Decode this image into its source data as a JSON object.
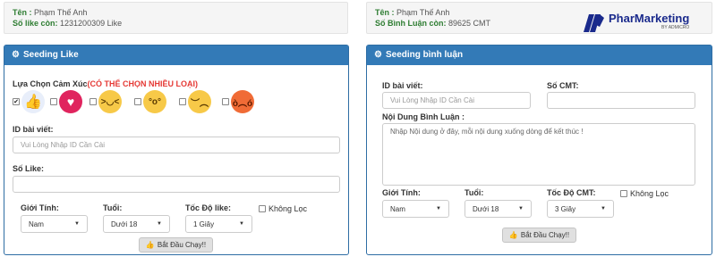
{
  "left_info": {
    "name_label": "Tên :",
    "name_value": "Phạm Thế Anh",
    "count_label": "Số like còn:",
    "count_value": "1231200309 Like"
  },
  "right_info": {
    "name_label": "Tên :",
    "name_value": "Phạm Thế Anh",
    "count_label": "Số Bình Luận còn:",
    "count_value": "89625 CMT"
  },
  "logo": {
    "brand": "PharMarketing",
    "by": "BY ADMICRO"
  },
  "like_panel": {
    "title": "Seeding Like",
    "emotion_label": "Lựa Chọn Cảm Xúc",
    "emotion_note": "(CÓ THỂ CHỌN NHIỀU LOẠI)",
    "emotions": [
      {
        "name": "like",
        "checked": true
      },
      {
        "name": "love",
        "checked": false
      },
      {
        "name": "haha",
        "checked": false
      },
      {
        "name": "wow",
        "checked": false
      },
      {
        "name": "sad",
        "checked": false
      },
      {
        "name": "angry",
        "checked": false
      }
    ],
    "post_id_label": "ID bài viết:",
    "post_id_placeholder": "Vui Lòng Nhập ID Cần Cài",
    "like_count_label": "Số Like:",
    "like_count_value": "",
    "gender_label": "Giới Tính:",
    "gender_value": "Nam",
    "age_label": "Tuổi:",
    "age_value": "Dưới 18",
    "speed_label": "Tốc Độ like:",
    "speed_value": "1 Giây",
    "nofilter_label": "Không Lọc",
    "start_label": "Bắt Đầu Chạy!!"
  },
  "comment_panel": {
    "title": "Seeding bình luận",
    "post_id_label": "ID bài viết:",
    "post_id_placeholder": "Vui Lòng Nhập ID Cần Cài",
    "cmt_count_label": "Số CMT:",
    "cmt_count_value": "",
    "content_label": "Nội Dung Bình Luận :",
    "content_placeholder": "Nhập Nội dung ở đây, mỗi nội dung xuống dòng để kết thúc !",
    "gender_label": "Giới Tính:",
    "gender_value": "Nam",
    "age_label": "Tuổi:",
    "age_value": "Dưới 18",
    "speed_label": "Tốc Độ CMT:",
    "speed_value": "3 Giây",
    "nofilter_label": "Không Lọc",
    "start_label": "Bắt Đầu Chạy!!"
  },
  "colors": {
    "panel_header": "#337ab7",
    "label_green": "#2e7d32",
    "note_red": "#e53935"
  }
}
